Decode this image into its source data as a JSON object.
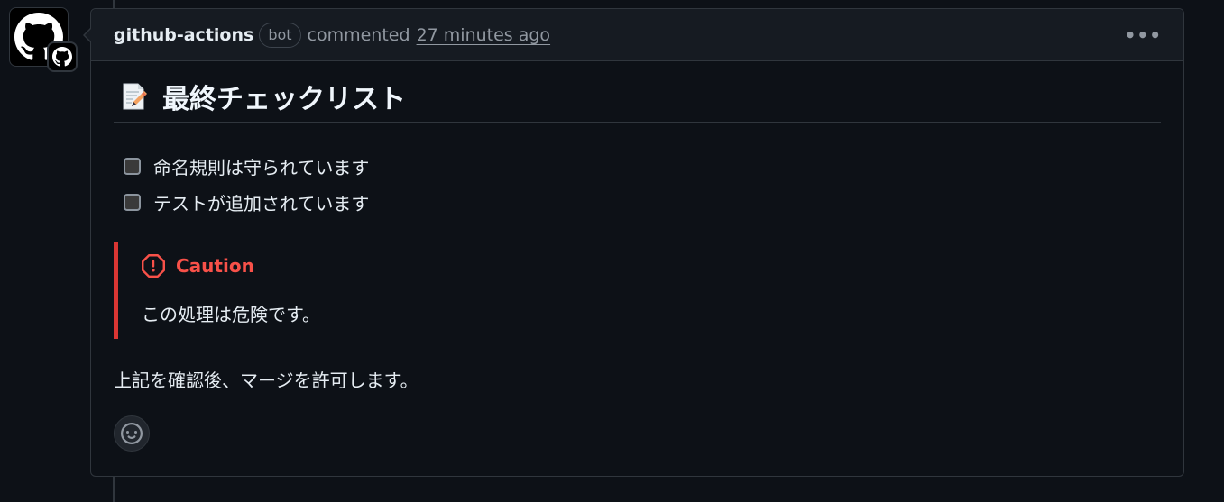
{
  "comment": {
    "author": "github-actions",
    "badge": "bot",
    "action": "commented",
    "time": "27 minutes ago",
    "menu_glyph": "•••"
  },
  "body": {
    "heading": "最終チェックリスト",
    "heading_emoji": "memo-icon",
    "checklist": [
      {
        "label": "命名規則は守られています",
        "checked": false
      },
      {
        "label": "テストが追加されています",
        "checked": false
      }
    ],
    "alert": {
      "type": "caution",
      "title": "Caution",
      "text": "この処理は危険です。",
      "color": "#f85149"
    },
    "footer_text": "上記を確認後、マージを許可します。"
  },
  "icons": {
    "avatar": "github-mark-icon",
    "avatar_badge": "github-app-badge-icon",
    "reaction": "smiley-icon",
    "kebab": "kebab-horizontal-icon"
  }
}
